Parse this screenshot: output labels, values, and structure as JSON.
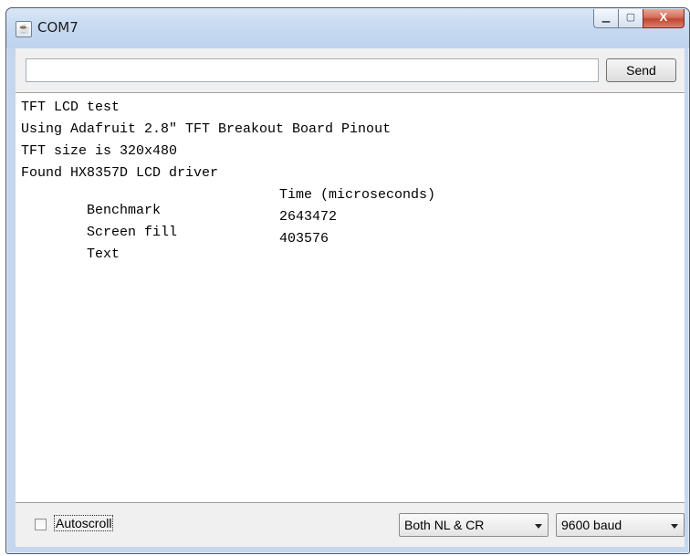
{
  "window": {
    "title": "COM7",
    "app_icon": "java-icon",
    "controls": {
      "minimize_icon": "minimize-icon",
      "maximize_icon": "maximize-icon",
      "close_icon": "close-icon",
      "close_glyph": "X"
    }
  },
  "input": {
    "value": "",
    "send_label": "Send"
  },
  "console": {
    "lines": [
      {
        "col1": "TFT LCD test",
        "col2": ""
      },
      {
        "col1": "Using Adafruit 2.8\" TFT Breakout Board Pinout",
        "col2": ""
      },
      {
        "col1": "TFT size is 320x480",
        "col2": ""
      },
      {
        "col1": "Found HX8357D LCD driver",
        "col2": ""
      },
      {
        "col1": "Benchmark",
        "col2": "Time (microseconds)"
      },
      {
        "col1": "Screen fill",
        "col2": "2643472"
      },
      {
        "col1": "Text",
        "col2": "403576"
      }
    ]
  },
  "footer": {
    "autoscroll_label": "Autoscroll",
    "autoscroll_checked": false,
    "line_ending": "Both NL & CR",
    "baud": "9600 baud"
  },
  "colors": {
    "close_button": "#c2462f",
    "titlebar": "#c8daf1",
    "console_bg": "#ffffff"
  }
}
